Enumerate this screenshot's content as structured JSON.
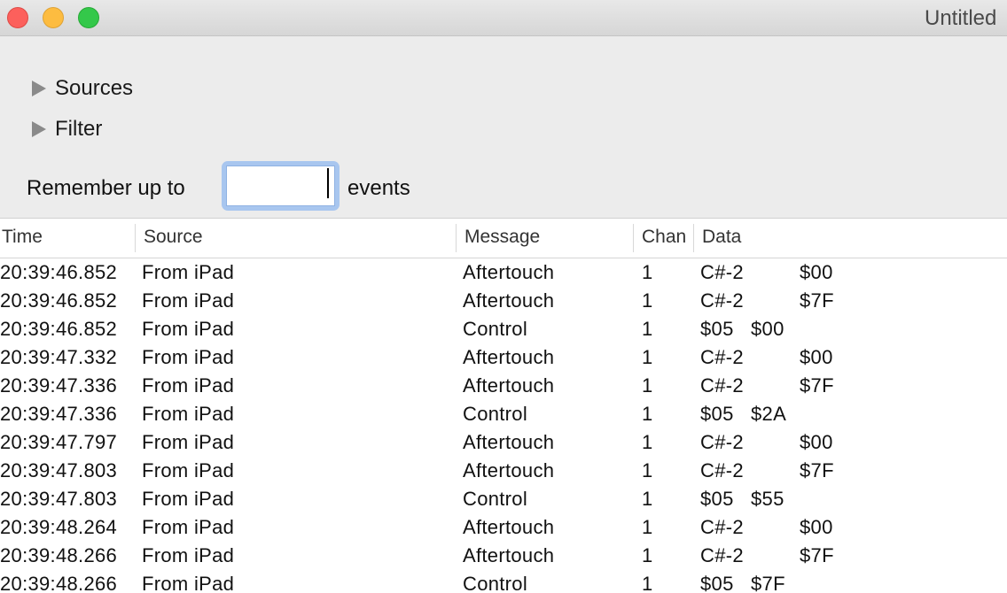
{
  "window": {
    "title": "Untitled"
  },
  "controls": {
    "sources_label": "Sources",
    "filter_label": "Filter",
    "remember_prefix": "Remember up to",
    "remember_value": "",
    "remember_suffix": "events"
  },
  "table": {
    "columns": [
      "Time",
      "Source",
      "Message",
      "Chan",
      "Data"
    ],
    "rows": [
      {
        "time": "20:39:46.852",
        "source": "From iPad",
        "message": "Aftertouch",
        "chan": "1",
        "data1": "C#-2",
        "data2": "$00"
      },
      {
        "time": "20:39:46.852",
        "source": "From iPad",
        "message": "Aftertouch",
        "chan": "1",
        "data1": "C#-2",
        "data2": "$7F"
      },
      {
        "time": "20:39:46.852",
        "source": "From iPad",
        "message": "Control",
        "chan": "1",
        "data1": "$05",
        "data2": "$00"
      },
      {
        "time": "20:39:47.332",
        "source": "From iPad",
        "message": "Aftertouch",
        "chan": "1",
        "data1": "C#-2",
        "data2": "$00"
      },
      {
        "time": "20:39:47.336",
        "source": "From iPad",
        "message": "Aftertouch",
        "chan": "1",
        "data1": "C#-2",
        "data2": "$7F"
      },
      {
        "time": "20:39:47.336",
        "source": "From iPad",
        "message": "Control",
        "chan": "1",
        "data1": "$05",
        "data2": "$2A"
      },
      {
        "time": "20:39:47.797",
        "source": "From iPad",
        "message": "Aftertouch",
        "chan": "1",
        "data1": "C#-2",
        "data2": "$00"
      },
      {
        "time": "20:39:47.803",
        "source": "From iPad",
        "message": "Aftertouch",
        "chan": "1",
        "data1": "C#-2",
        "data2": "$7F"
      },
      {
        "time": "20:39:47.803",
        "source": "From iPad",
        "message": "Control",
        "chan": "1",
        "data1": "$05",
        "data2": "$55"
      },
      {
        "time": "20:39:48.264",
        "source": "From iPad",
        "message": "Aftertouch",
        "chan": "1",
        "data1": "C#-2",
        "data2": "$00"
      },
      {
        "time": "20:39:48.266",
        "source": "From iPad",
        "message": "Aftertouch",
        "chan": "1",
        "data1": "C#-2",
        "data2": "$7F"
      },
      {
        "time": "20:39:48.266",
        "source": "From iPad",
        "message": "Control",
        "chan": "1",
        "data1": "$05",
        "data2": "$7F"
      }
    ]
  }
}
